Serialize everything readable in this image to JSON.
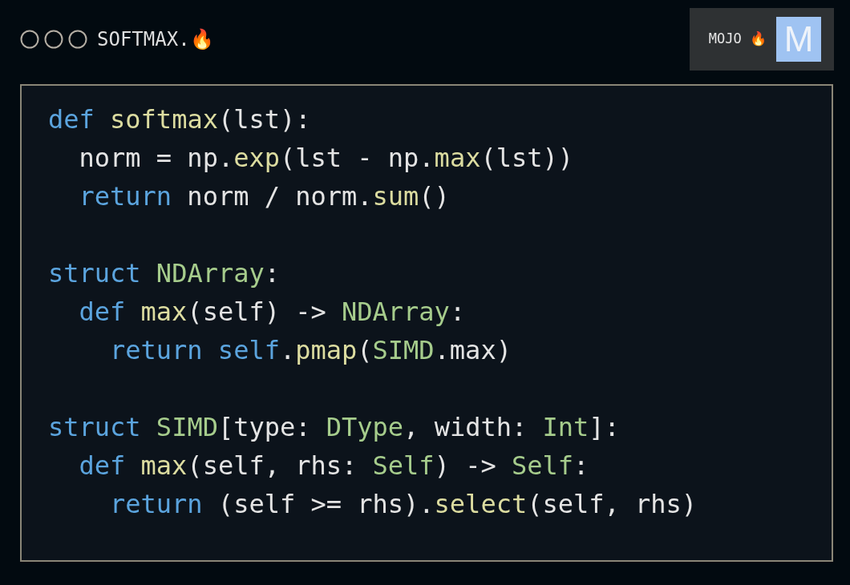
{
  "window": {
    "title": "SOFTMAX.🔥"
  },
  "badge": {
    "label": "MOJO 🔥",
    "logo": "M"
  },
  "code": [
    {
      "tokens": [
        {
          "kind": "keyword",
          "text": "def "
        },
        {
          "kind": "function",
          "text": "softmax"
        },
        {
          "kind": "plain",
          "text": "(lst):"
        }
      ],
      "children": [
        {
          "tokens": [
            {
              "kind": "plain",
              "text": "norm = np."
            },
            {
              "kind": "function",
              "text": "exp"
            },
            {
              "kind": "plain",
              "text": "(lst - np."
            },
            {
              "kind": "function",
              "text": "max"
            },
            {
              "kind": "plain",
              "text": "(lst))"
            }
          ]
        },
        {
          "tokens": [
            {
              "kind": "keyword",
              "text": "return "
            },
            {
              "kind": "plain",
              "text": "norm / norm."
            },
            {
              "kind": "function",
              "text": "sum"
            },
            {
              "kind": "plain",
              "text": "()"
            }
          ]
        }
      ]
    },
    {
      "tokens": [
        {
          "kind": "keyword",
          "text": "struct "
        },
        {
          "kind": "type",
          "text": "NDArray"
        },
        {
          "kind": "plain",
          "text": ":"
        }
      ],
      "children": [
        {
          "tokens": [
            {
              "kind": "keyword",
              "text": "def "
            },
            {
              "kind": "function",
              "text": "max"
            },
            {
              "kind": "plain",
              "text": "(self) -> "
            },
            {
              "kind": "type",
              "text": "NDArray"
            },
            {
              "kind": "plain",
              "text": ":"
            }
          ],
          "children": [
            {
              "tokens": [
                {
                  "kind": "keyword",
                  "text": "return self"
                },
                {
                  "kind": "plain",
                  "text": "."
                },
                {
                  "kind": "function",
                  "text": "pmap"
                },
                {
                  "kind": "plain",
                  "text": "("
                },
                {
                  "kind": "type",
                  "text": "SIMD"
                },
                {
                  "kind": "plain",
                  "text": ".max)"
                }
              ]
            }
          ]
        }
      ]
    },
    {
      "tokens": [
        {
          "kind": "keyword",
          "text": "struct "
        },
        {
          "kind": "type",
          "text": "SIMD"
        },
        {
          "kind": "plain",
          "text": "[type: "
        },
        {
          "kind": "type",
          "text": "DType"
        },
        {
          "kind": "plain",
          "text": ", width: "
        },
        {
          "kind": "type",
          "text": "Int"
        },
        {
          "kind": "plain",
          "text": "]:"
        }
      ],
      "children": [
        {
          "tokens": [
            {
              "kind": "keyword",
              "text": "def "
            },
            {
              "kind": "function",
              "text": "max"
            },
            {
              "kind": "plain",
              "text": "(self, rhs: "
            },
            {
              "kind": "type",
              "text": "Self"
            },
            {
              "kind": "plain",
              "text": ") -> "
            },
            {
              "kind": "type",
              "text": "Self"
            },
            {
              "kind": "plain",
              "text": ":"
            }
          ],
          "children": [
            {
              "tokens": [
                {
                  "kind": "keyword",
                  "text": "return "
                },
                {
                  "kind": "plain",
                  "text": "(self >= rhs)."
                },
                {
                  "kind": "function",
                  "text": "select"
                },
                {
                  "kind": "plain",
                  "text": "(self, rhs)"
                }
              ]
            }
          ]
        }
      ]
    }
  ]
}
